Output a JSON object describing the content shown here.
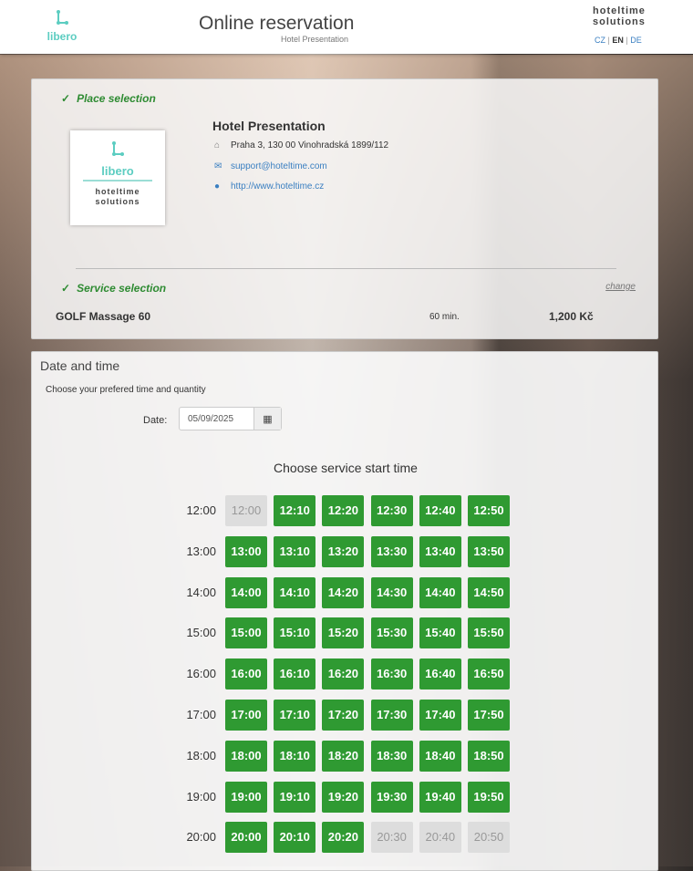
{
  "header": {
    "logo": "libero",
    "title": "Online reservation",
    "subtitle": "Hotel Presentation",
    "brand_line1": "hoteltime",
    "brand_line2": "solutions",
    "languages": [
      "CZ",
      "EN",
      "DE"
    ],
    "active_language": "EN"
  },
  "place": {
    "step_label": "Place selection",
    "hotel_name": "Hotel Presentation",
    "address": "Praha 3, 130 00 Vinohradská 1899/112",
    "email": "support@hoteltime.com",
    "website": "http://www.hoteltime.cz",
    "logo_text": "libero",
    "logo_sub1": "hoteltime",
    "logo_sub2": "solutions"
  },
  "service": {
    "step_label": "Service selection",
    "change_label": "change",
    "name": "GOLF Massage 60",
    "duration": "60 min.",
    "price": "1,200 Kč"
  },
  "datetime": {
    "title": "Date and time",
    "hint": "Choose your prefered time and quantity",
    "date_label": "Date:",
    "date_value": "05/09/2025",
    "choose_title": "Choose service start time"
  },
  "colors": {
    "available": "#2f9a32",
    "unavailable": "#dddddd",
    "step": "#2e8b32"
  },
  "slots": [
    {
      "hour": "12:00",
      "times": [
        "12:00",
        "12:10",
        "12:20",
        "12:30",
        "12:40",
        "12:50"
      ],
      "available": [
        false,
        true,
        true,
        true,
        true,
        true
      ]
    },
    {
      "hour": "13:00",
      "times": [
        "13:00",
        "13:10",
        "13:20",
        "13:30",
        "13:40",
        "13:50"
      ],
      "available": [
        true,
        true,
        true,
        true,
        true,
        true
      ]
    },
    {
      "hour": "14:00",
      "times": [
        "14:00",
        "14:10",
        "14:20",
        "14:30",
        "14:40",
        "14:50"
      ],
      "available": [
        true,
        true,
        true,
        true,
        true,
        true
      ]
    },
    {
      "hour": "15:00",
      "times": [
        "15:00",
        "15:10",
        "15:20",
        "15:30",
        "15:40",
        "15:50"
      ],
      "available": [
        true,
        true,
        true,
        true,
        true,
        true
      ]
    },
    {
      "hour": "16:00",
      "times": [
        "16:00",
        "16:10",
        "16:20",
        "16:30",
        "16:40",
        "16:50"
      ],
      "available": [
        true,
        true,
        true,
        true,
        true,
        true
      ]
    },
    {
      "hour": "17:00",
      "times": [
        "17:00",
        "17:10",
        "17:20",
        "17:30",
        "17:40",
        "17:50"
      ],
      "available": [
        true,
        true,
        true,
        true,
        true,
        true
      ]
    },
    {
      "hour": "18:00",
      "times": [
        "18:00",
        "18:10",
        "18:20",
        "18:30",
        "18:40",
        "18:50"
      ],
      "available": [
        true,
        true,
        true,
        true,
        true,
        true
      ]
    },
    {
      "hour": "19:00",
      "times": [
        "19:00",
        "19:10",
        "19:20",
        "19:30",
        "19:40",
        "19:50"
      ],
      "available": [
        true,
        true,
        true,
        true,
        true,
        true
      ]
    },
    {
      "hour": "20:00",
      "times": [
        "20:00",
        "20:10",
        "20:20",
        "20:30",
        "20:40",
        "20:50"
      ],
      "available": [
        true,
        true,
        true,
        false,
        false,
        false
      ]
    }
  ]
}
